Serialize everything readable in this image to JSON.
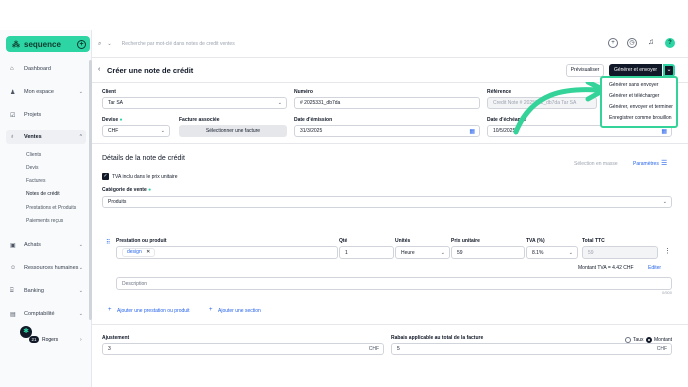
{
  "app": {
    "brand": "sequence"
  },
  "search": {
    "placeholder": "Recherche par mot-clé dans notes de credit ventes"
  },
  "sidebar": {
    "items": [
      {
        "label": "Dashboard"
      },
      {
        "label": "Mon espace"
      },
      {
        "label": "Projets"
      },
      {
        "label": "Ventes"
      },
      {
        "label": "Achats"
      },
      {
        "label": "Ressources humaines"
      },
      {
        "label": "Banking"
      },
      {
        "label": "Comptabilité"
      }
    ],
    "sub_items": [
      {
        "label": "Clients"
      },
      {
        "label": "Devis"
      },
      {
        "label": "Factures"
      },
      {
        "label": "Notes de crédit"
      },
      {
        "label": "Prestations et Produits"
      },
      {
        "label": "Paiements reçus"
      }
    ],
    "user": "Rogers",
    "badge": "21"
  },
  "header": {
    "title": "Créer une note de crédit",
    "preview_label": "Prévisualiser",
    "generate_label": "Générer et envoyer"
  },
  "dropdown": {
    "items": [
      "Générer sans envoyer",
      "Générer et télécharger",
      "Générer, envoyer et terminer",
      "Enregistrer comme brouillon"
    ]
  },
  "form": {
    "client_label": "Client",
    "client_value": "Tar SA",
    "numero_label": "Numéro",
    "numero_value": "# 2025331_db7da",
    "reference_label": "Référence",
    "reference_value": "Credit Note # 2025331_db7da Tar SA",
    "devise_label": "Devise",
    "devise_value": "CHF",
    "facture_label": "Facture associée",
    "facture_button": "Sélectionner une facture",
    "date_emission_label": "Date d'émission",
    "date_emission_value": "31/3/2025",
    "date_echeance_label": "Date d'échéance",
    "date_echeance_value": "10/5/2025"
  },
  "details": {
    "title": "Détails de la note de crédit",
    "selection_label": "Sélection en masse",
    "parametres_label": "Paramètres",
    "tva_checkbox_label": "TVA inclu dans le prix unitaire",
    "categorie_label": "Catégorie de vente",
    "categorie_value": "Produits"
  },
  "table": {
    "headers": {
      "prestation": "Prestation ou produit",
      "qte": "Qté",
      "unites": "Unités",
      "prix": "Prix unitaire",
      "tva": "TVA (%)",
      "total": "Total TTC"
    },
    "row": {
      "tag": "design",
      "qte": "1",
      "unite": "Heure",
      "prix": "59",
      "tva": "8.1%",
      "total": "59"
    },
    "montant_tva": "Montant TVA = 4.42 CHF",
    "editer": "Editer",
    "description_placeholder": "Description",
    "char_count": "0/500",
    "add_product": "Ajouter une prestation ou produit",
    "add_section": "Ajouter une section"
  },
  "totals": {
    "ajustement_label": "Ajustement",
    "ajustement_value": "3",
    "ajustement_currency": "CHF",
    "rabais_label": "Rabais applicable au total de la facture",
    "rabais_value": "5",
    "rabais_currency": "CHF",
    "taux_label": "Taux",
    "montant_label": "Montant"
  }
}
